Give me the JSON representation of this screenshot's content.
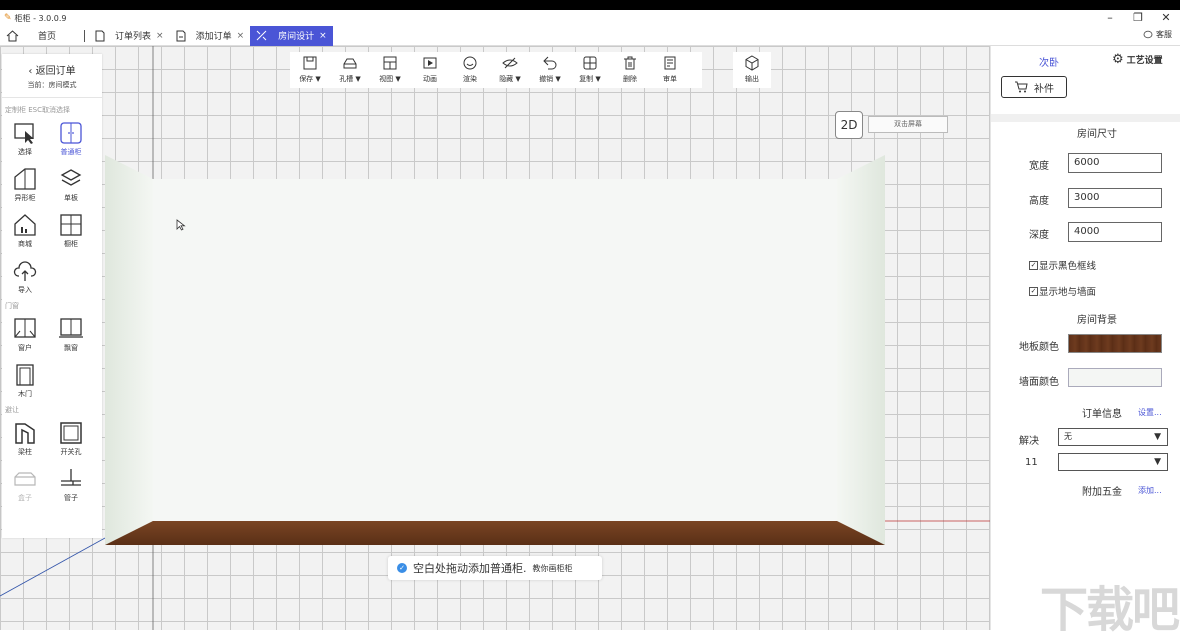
{
  "window": {
    "title": "柜柜 - 3.0.0.9",
    "controls": [
      "–",
      "❐",
      "✕"
    ]
  },
  "tabs": [
    {
      "label": "首页"
    },
    {
      "label": "订单列表",
      "close": "×"
    },
    {
      "label": "添加订单",
      "close": "×"
    },
    {
      "label": "房间设计",
      "close": "×",
      "active": true
    }
  ],
  "kefu": "客服",
  "left": {
    "back": "返回订单",
    "mode": "当前：房间模式",
    "section_custom": "定制柜  ESC取消选择",
    "tools_custom": [
      {
        "name": "select",
        "label": "选择"
      },
      {
        "name": "normal-cabinet",
        "label": "普通柜",
        "selected": true
      },
      {
        "name": "shaped-cabinet",
        "label": "异形柜"
      },
      {
        "name": "single-board",
        "label": "单板"
      },
      {
        "name": "mall",
        "label": "商城"
      },
      {
        "name": "kitchen-cabinet",
        "label": "橱柜"
      },
      {
        "name": "import",
        "label": "导入"
      }
    ],
    "section_door": "门窗",
    "tools_door": [
      {
        "name": "window",
        "label": "窗户"
      },
      {
        "name": "bay-window",
        "label": "飘窗"
      },
      {
        "name": "wood-door",
        "label": "木门"
      }
    ],
    "section_avoid": "避让",
    "tools_avoid": [
      {
        "name": "beam-column",
        "label": "梁柱"
      },
      {
        "name": "switch-hole",
        "label": "开关孔"
      },
      {
        "name": "box",
        "label": "盒子",
        "disabled": true
      },
      {
        "name": "pipe",
        "label": "管子"
      }
    ]
  },
  "toolbar": [
    {
      "name": "save",
      "label": "保存 ▼"
    },
    {
      "name": "hole-slot",
      "label": "孔槽 ▼"
    },
    {
      "name": "view",
      "label": "视图 ▼"
    },
    {
      "name": "animation",
      "label": "动画"
    },
    {
      "name": "render",
      "label": "渲染"
    },
    {
      "name": "hide",
      "label": "隐藏 ▼"
    },
    {
      "name": "undo",
      "label": "撤销 ▼"
    },
    {
      "name": "copy",
      "label": "复制 ▼"
    },
    {
      "name": "delete",
      "label": "删除"
    },
    {
      "name": "review",
      "label": "审单"
    }
  ],
  "export": "输出",
  "view": {
    "btn_2d": "2D",
    "dual_screen": "双击屏幕"
  },
  "hint": {
    "text": "空白处拖动添加普通柜.",
    "small": "教你画柜柜"
  },
  "right": {
    "room_name": "次卧",
    "process_settings": "工艺设置",
    "bujian": "补件",
    "room_size_title": "房间尺寸",
    "width_label": "宽度",
    "width_value": "6000",
    "height_label": "高度",
    "height_value": "3000",
    "depth_label": "深度",
    "depth_value": "4000",
    "check_black_frame": "显示黑色框线",
    "check_floor_wall": "显示地与墙面",
    "room_bg_title": "房间背景",
    "floor_color_label": "地板颜色",
    "wall_color_label": "墙面颜色",
    "order_info_title": "订单信息",
    "order_info_link": "设置...",
    "solve_label": "解决",
    "solve_value": "无",
    "eleven_label": "11",
    "eleven_value": "",
    "hardware_title": "附加五金",
    "hardware_link": "添加..."
  },
  "colors": {
    "accent": "#4a55d6",
    "floor": "#6b3a1f",
    "wall": "#f4f6f4"
  },
  "watermark": "下载吧"
}
